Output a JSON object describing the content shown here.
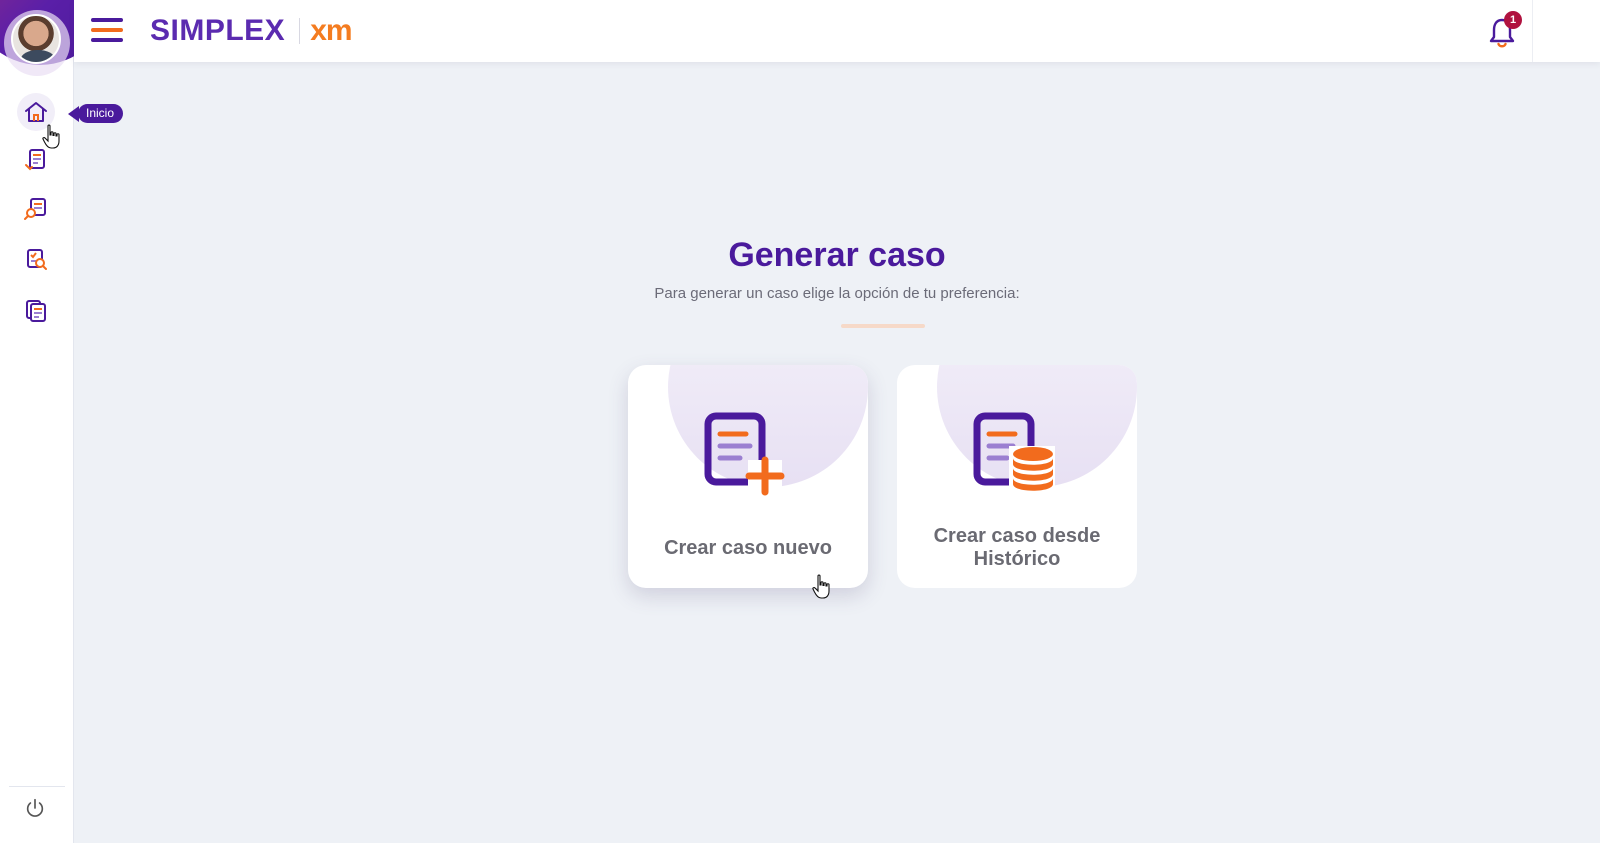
{
  "sidebar": {
    "tooltip": "Inicio",
    "items": [
      {
        "name": "home-icon"
      },
      {
        "name": "document-reply-icon"
      },
      {
        "name": "document-search-icon"
      },
      {
        "name": "checklist-search-icon"
      },
      {
        "name": "documents-list-icon"
      }
    ],
    "power_icon": "power-icon"
  },
  "header": {
    "brand_simplex": "SIMPLEX",
    "brand_xm": "xm",
    "notification_count": "1"
  },
  "main": {
    "title": "Generar caso",
    "subtitle": "Para generar un caso elige la opción de tu preferencia:",
    "cards": [
      {
        "label": "Crear caso nuevo",
        "icon": "document-add-icon"
      },
      {
        "label_line1": "Crear caso desde",
        "label_line2": "Histórico",
        "icon": "document-database-icon"
      }
    ]
  },
  "colors": {
    "primary": "#4a1a9c",
    "accent": "#f26b1d",
    "background": "#eef1f6",
    "badge": "#b0123f"
  }
}
